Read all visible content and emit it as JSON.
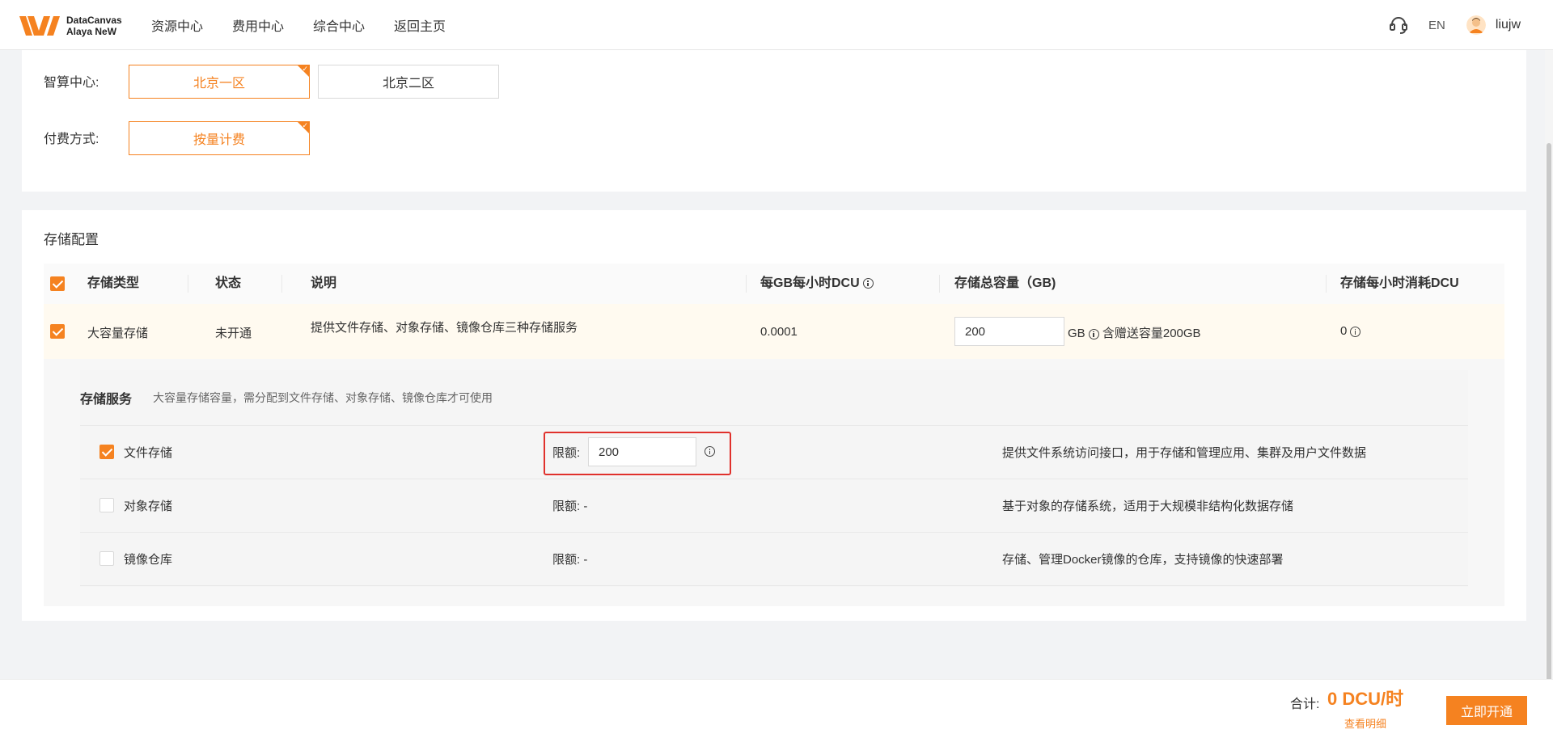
{
  "header": {
    "logo_line1": "DataCanvas",
    "logo_line2": "Alaya NeW",
    "nav": [
      "资源中心",
      "费用中心",
      "综合中心",
      "返回主页"
    ],
    "lang": "EN",
    "username": "liujw"
  },
  "top_config": {
    "center_label": "智算中心:",
    "center_options": [
      {
        "label": "北京一区",
        "selected": true
      },
      {
        "label": "北京二区",
        "selected": false
      }
    ],
    "payment_label": "付费方式:",
    "payment_options": [
      {
        "label": "按量计费",
        "selected": true
      }
    ]
  },
  "storage": {
    "title": "存储配置",
    "columns": [
      "存储类型",
      "状态",
      "说明",
      "每GB每小时DCU",
      "存储总容量（GB)",
      "存储每小时消耗DCU"
    ],
    "row": {
      "checked": true,
      "type": "大容量存储",
      "status": "未开通",
      "desc": "提供文件存储、对象存储、镜像仓库三种存储服务",
      "dcu_per_gb": "0.0001",
      "capacity_value": "200",
      "capacity_unit": "GB",
      "gift_text": "含赠送容量200GB",
      "hourly_dcu": "0"
    },
    "services": {
      "title": "存储服务",
      "desc": "大容量存储容量，需分配到文件存储、对象存储、镜像仓库才可使用",
      "items": [
        {
          "name": "文件存储",
          "checked": true,
          "limit_label": "限额:",
          "limit_value": "200",
          "desc": "提供文件系统访问接口，用于存储和管理应用、集群及用户文件数据"
        },
        {
          "name": "对象存储",
          "checked": false,
          "limit_label": "限额:",
          "limit_value": "-",
          "desc": "基于对象的存储系统，适用于大规模非结构化数据存储"
        },
        {
          "name": "镜像仓库",
          "checked": false,
          "limit_label": "限额:",
          "limit_value": "-",
          "desc": "存储、管理Docker镜像的仓库，支持镜像的快速部署"
        }
      ]
    }
  },
  "footer": {
    "total_label": "合计:",
    "total_value": "0 DCU/时",
    "detail_link": "查看明细",
    "submit_label": "立即开通"
  },
  "colors": {
    "accent": "#f58220",
    "highlight": "#e0312c"
  }
}
